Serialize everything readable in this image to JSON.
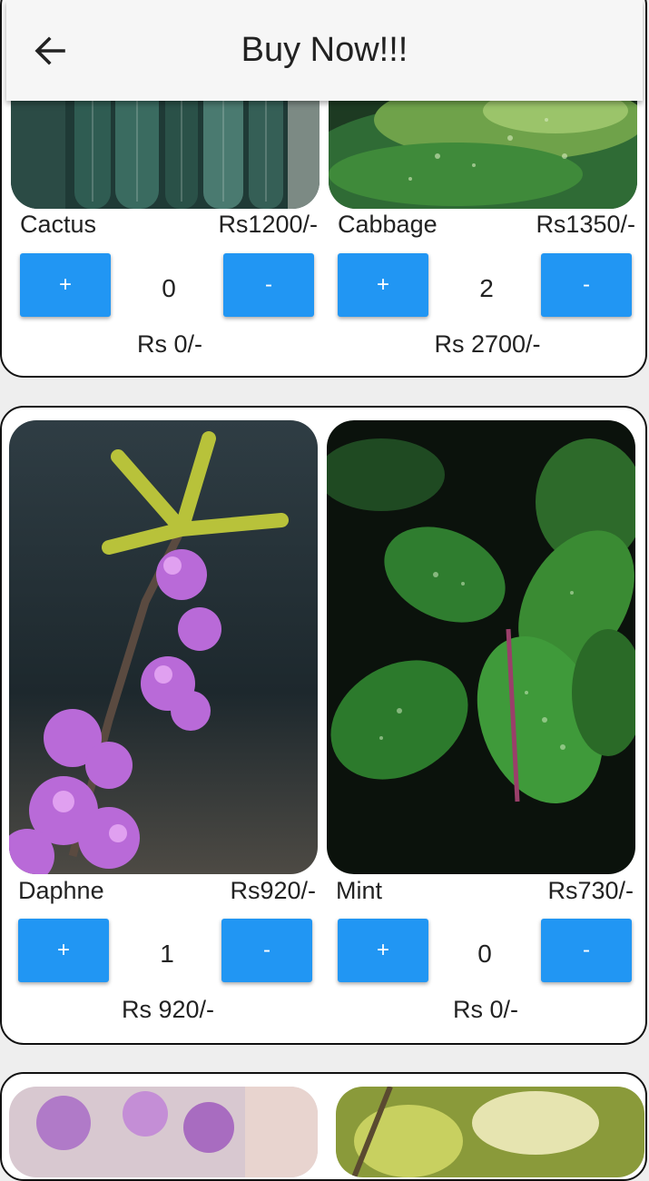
{
  "appbar": {
    "title": "Buy Now!!!",
    "back_icon": "arrow-left-icon"
  },
  "colors": {
    "button": "#2196f3",
    "card_border": "#111111",
    "background": "#eeeeee"
  },
  "rows": [
    {
      "items": [
        {
          "name": "Cactus",
          "price": "Rs1200/-",
          "plus": "+",
          "minus": "-",
          "qty": "0",
          "total": "Rs 0/-"
        },
        {
          "name": "Cabbage",
          "price": "Rs1350/-",
          "plus": "+",
          "minus": "-",
          "qty": "2",
          "total": "Rs 2700/-"
        }
      ]
    },
    {
      "items": [
        {
          "name": "Daphne",
          "price": "Rs920/-",
          "plus": "+",
          "minus": "-",
          "qty": "1",
          "total": "Rs 920/-"
        },
        {
          "name": "Mint",
          "price": "Rs730/-",
          "plus": "+",
          "minus": "-",
          "qty": "0",
          "total": "Rs 0/-"
        }
      ]
    }
  ]
}
